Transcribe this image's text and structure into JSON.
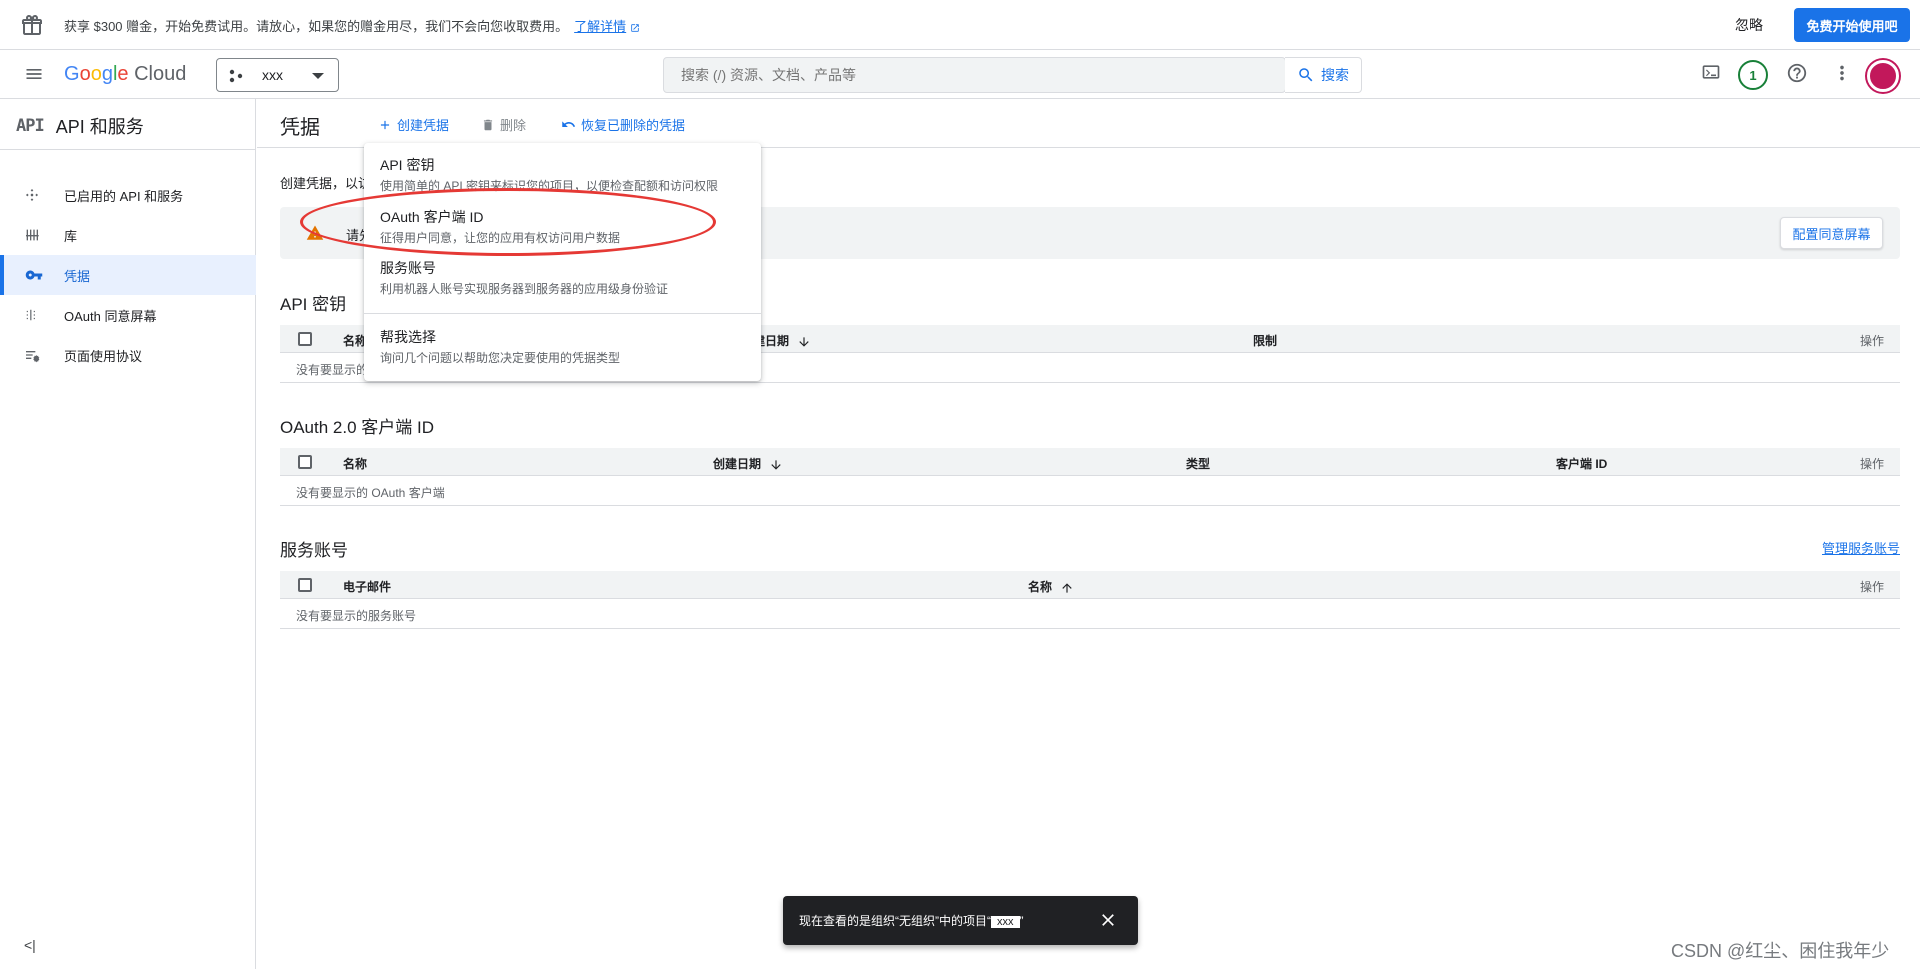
{
  "promo": {
    "text": "获享 $300 赠金，开始免费试用。请放心，如果您的赠金用尽，我们不会向您收取费用。",
    "link": "了解详情",
    "dismiss": "忽略",
    "cta": "免费开始使用吧"
  },
  "header": {
    "logo": "Google Cloud",
    "project": "xxx",
    "search_placeholder": "搜索 (/) 资源、文档、产品等",
    "search_button": "搜索",
    "notification_count": "1"
  },
  "sidebar": {
    "title_icon_text": "API",
    "title": "API 和服务",
    "items": [
      {
        "label": "已启用的 API 和服务",
        "icon": "apis-icon"
      },
      {
        "label": "库",
        "icon": "library-icon"
      },
      {
        "label": "凭据",
        "icon": "key-icon",
        "active": true
      },
      {
        "label": "OAuth 同意屏幕",
        "icon": "consent-icon"
      },
      {
        "label": "页面使用协议",
        "icon": "agreements-icon"
      }
    ],
    "collapse_glyph": "<|"
  },
  "toolbar": {
    "title": "凭据",
    "create": "创建凭据",
    "delete": "删除",
    "restore": "恢复已删除的凭据"
  },
  "main": {
    "intro": "创建凭据，以访",
    "warning": "请先",
    "configure_consent": "配置同意屏幕"
  },
  "api_keys": {
    "title": "API 密钥",
    "columns": [
      "名称",
      "创建日期",
      "限制",
      "操作"
    ],
    "empty": "没有要显示的"
  },
  "oauth": {
    "title": "OAuth 2.0 客户端 ID",
    "columns": [
      "名称",
      "创建日期",
      "类型",
      "客户端 ID",
      "操作"
    ],
    "empty": "没有要显示的 OAuth 客户端"
  },
  "service_accounts": {
    "title": "服务账号",
    "manage": "管理服务账号",
    "columns": [
      "电子邮件",
      "名称",
      "操作"
    ],
    "empty": "没有要显示的服务账号"
  },
  "dropdown": {
    "items": [
      {
        "title": "API 密钥",
        "subtitle": "使用简单的 API 密钥来标识您的项目，以便检查配额和访问权限"
      },
      {
        "title": "OAuth 客户端 ID",
        "subtitle": "征得用户同意，让您的应用有权访问用户数据"
      },
      {
        "title": "服务账号",
        "subtitle": "利用机器人账号实现服务器到服务器的应用级身份验证"
      },
      {
        "title": "帮我选择",
        "subtitle": "询问几个问题以帮助您决定要使用的凭据类型"
      }
    ]
  },
  "snackbar": {
    "message": "现在查看的是组织“无组织”中的项目“",
    "project": "xxx",
    "suffix": "”"
  },
  "watermark": "CSDN @红尘、困住我年少",
  "colors": {
    "accent": "#1a73e8",
    "highlight_oval": "#e53935",
    "warning": "#e37400",
    "avatar": "#c2185b"
  }
}
